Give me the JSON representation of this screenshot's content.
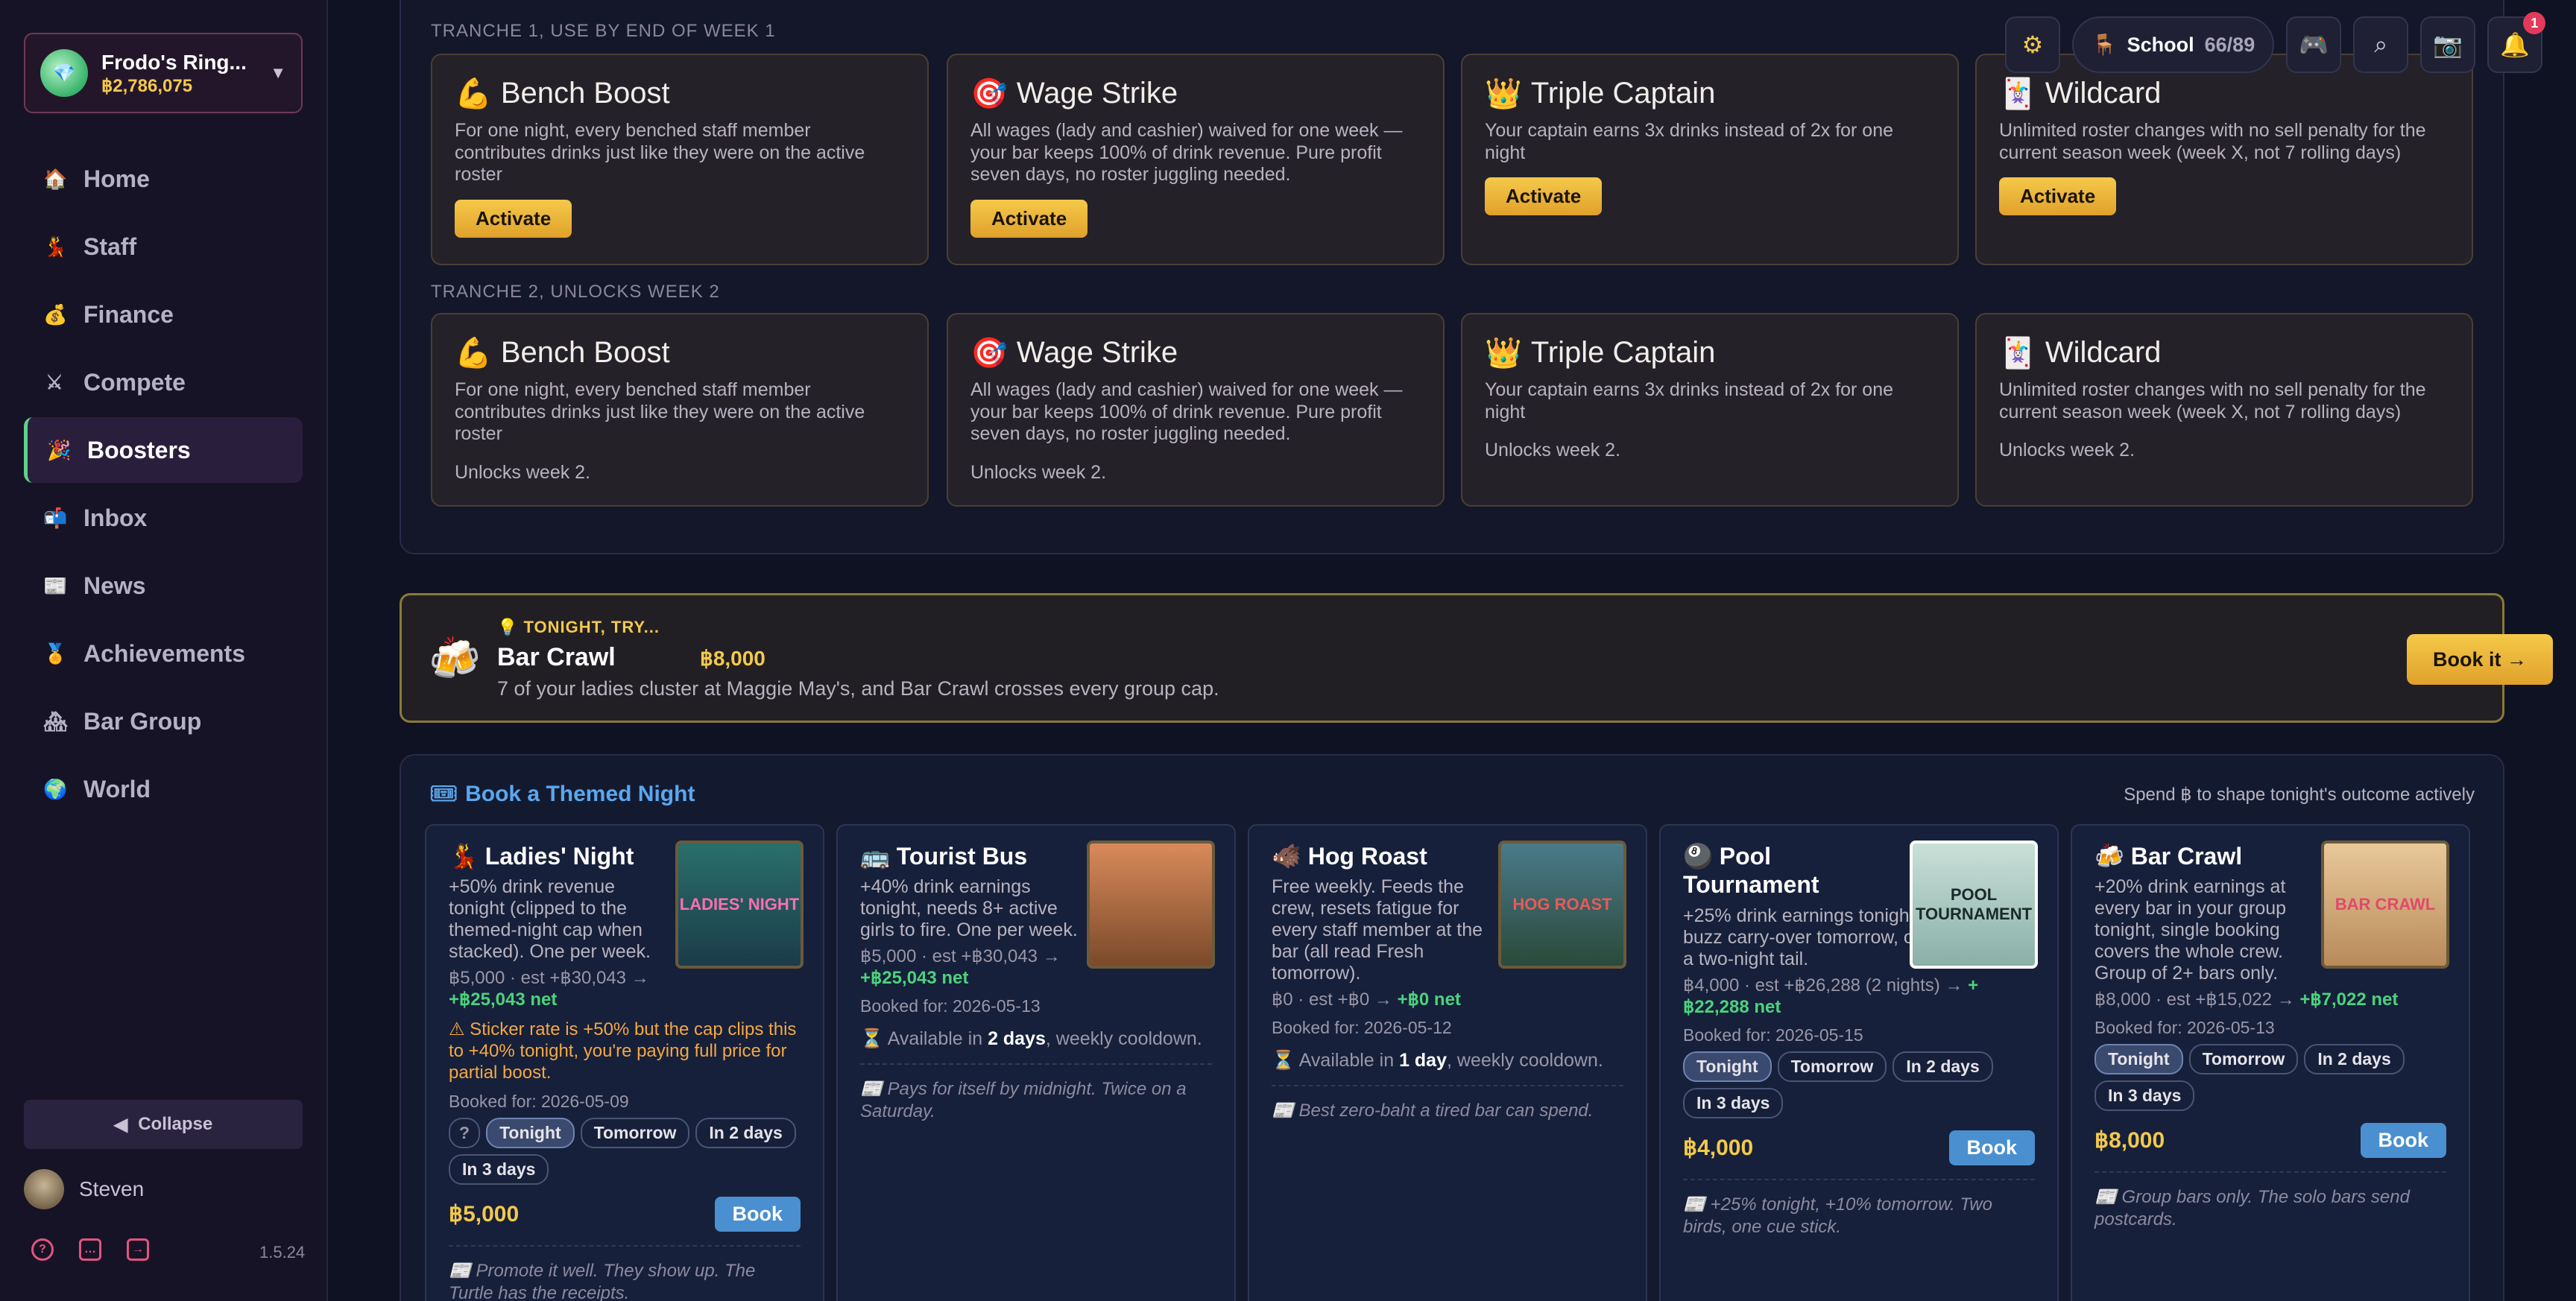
{
  "sidebar": {
    "bar_name": "Frodo's Ring...",
    "bar_balance": "฿2,786,075",
    "items": [
      {
        "label": "Home",
        "icon": "🏠"
      },
      {
        "label": "Staff",
        "icon": "💃"
      },
      {
        "label": "Finance",
        "icon": "💰"
      },
      {
        "label": "Compete",
        "icon": "⚔"
      },
      {
        "label": "Boosters",
        "icon": "🎉"
      },
      {
        "label": "Inbox",
        "icon": "📬"
      },
      {
        "label": "News",
        "icon": "📰"
      },
      {
        "label": "Achievements",
        "icon": "🏅"
      },
      {
        "label": "Bar Group",
        "icon": "🏘"
      },
      {
        "label": "World",
        "icon": "🌍"
      }
    ],
    "collapse_label": "Collapse",
    "user_name": "Steven",
    "version": "1.5.24"
  },
  "header": {
    "school_label": "School",
    "school_count": "66/89",
    "notification_count": "1"
  },
  "tranches": [
    {
      "label": "TRANCHE 1, USE BY END OF WEEK 1",
      "cards": [
        {
          "icon": "💪",
          "title": "Bench Boost",
          "desc": "For one night, every benched staff member contributes drinks just like they were on the active roster",
          "action": "Activate"
        },
        {
          "icon": "🎯",
          "title": "Wage Strike",
          "desc": "All wages (lady and cashier) waived for one week — your bar keeps 100% of drink revenue. Pure profit seven days, no roster juggling needed.",
          "action": "Activate"
        },
        {
          "icon": "👑",
          "title": "Triple Captain",
          "desc": "Your captain earns 3x drinks instead of 2x for one night",
          "action": "Activate"
        },
        {
          "icon": "🃏",
          "title": "Wildcard",
          "desc": "Unlimited roster changes with no sell penalty for the current season week (week X, not 7 rolling days)",
          "action": "Activate"
        }
      ]
    },
    {
      "label": "TRANCHE 2, UNLOCKS WEEK 2",
      "cards": [
        {
          "icon": "💪",
          "title": "Bench Boost",
          "desc": "For one night, every benched staff member contributes drinks just like they were on the active roster",
          "note": "Unlocks week 2."
        },
        {
          "icon": "🎯",
          "title": "Wage Strike",
          "desc": "All wages (lady and cashier) waived for one week — your bar keeps 100% of drink revenue. Pure profit seven days, no roster juggling needed.",
          "note": "Unlocks week 2."
        },
        {
          "icon": "👑",
          "title": "Triple Captain",
          "desc": "Your captain earns 3x drinks instead of 2x for one night",
          "note": "Unlocks week 2."
        },
        {
          "icon": "🃏",
          "title": "Wildcard",
          "desc": "Unlimited roster changes with no sell penalty for the current season week (week X, not 7 rolling days)",
          "note": "Unlocks week 2."
        }
      ]
    }
  ],
  "tonight": {
    "kicker": "💡 TONIGHT, TRY...",
    "title": "Bar Crawl",
    "price": "฿8,000",
    "desc": "7 of your ladies cluster at Maggie May's, and Bar Crawl crosses every group cap.",
    "button": "Book it →"
  },
  "themed": {
    "title": "Book a Themed Night",
    "subtitle": "Spend ฿ to shape tonight's outcome actively",
    "nights": [
      {
        "icon": "💃",
        "title": "Ladies' Night",
        "img_label": "LADIES' NIGHT",
        "desc": "+50% drink revenue tonight (clipped to the themed-night cap when stacked). One per week.",
        "price_line": "฿5,000 · est +฿30,043 →",
        "net": "+฿25,043 net",
        "warning": "⚠ Sticker rate is +50% but the cap clips this to +40% tonight, you're paying full price for partial boost.",
        "booked": "Booked for: 2026-05-09",
        "pills": [
          "Tonight",
          "Tomorrow",
          "In 2 days",
          "In 3 days"
        ],
        "help": "?",
        "price": "฿5,000",
        "book": "Book",
        "quote": "📰 Promote it well. They show up. The Turtle has the receipts."
      },
      {
        "icon": "🚌",
        "title": "Tourist Bus",
        "img_label": "",
        "desc": "+40% drink earnings tonight, needs 8+ active girls to fire. One per week.",
        "price_line": "฿5,000 · est +฿30,043 →",
        "net": "+฿25,043 net",
        "booked": "Booked for: 2026-05-13",
        "avail_pre": "⏳ Available in",
        "avail_b": "2 days",
        "avail_post": ", weekly cooldown.",
        "quote": "📰 Pays for itself by midnight. Twice on a Saturday."
      },
      {
        "icon": "🐗",
        "title": "Hog Roast",
        "img_label": "HOG ROAST",
        "desc": "Free weekly. Feeds the crew, resets fatigue for every staff member at the bar (all read Fresh tomorrow).",
        "price_line": "฿0 · est +฿0 →",
        "net": "+฿0 net",
        "booked": "Booked for: 2026-05-12",
        "avail_pre": "⏳ Available in",
        "avail_b": "1 day",
        "avail_post": ", weekly cooldown.",
        "quote": "📰 Best zero-baht a tired bar can spend."
      },
      {
        "icon": "🎱",
        "title": "Pool Tournament",
        "img_label": "POOL TOURNAMENT",
        "desc": "+25% drink earnings tonight AND a +10% buzz carry-over tomorrow, only event with a two-night tail.",
        "price_line": "฿4,000 · est +฿26,288 (2 nights) →",
        "net": "+฿22,288 net",
        "booked": "Booked for: 2026-05-15",
        "pills": [
          "Tonight",
          "Tomorrow",
          "In 2 days",
          "In 3 days"
        ],
        "price": "฿4,000",
        "book": "Book",
        "quote": "📰 +25% tonight, +10% tomorrow. Two birds, one cue stick."
      },
      {
        "icon": "🍻",
        "title": "Bar Crawl",
        "img_label": "BAR CRAWL",
        "desc": "+20% drink earnings at every bar in your group tonight, single booking covers the whole crew. Group of 2+ bars only.",
        "price_line": "฿8,000 · est +฿15,022 →",
        "net": "+฿7,022 net",
        "booked": "Booked for: 2026-05-13",
        "pills": [
          "Tonight",
          "Tomorrow",
          "In 2 days",
          "In 3 days"
        ],
        "price": "฿8,000",
        "book": "Book",
        "quote": "📰 Group bars only. The solo bars send postcards."
      }
    ]
  },
  "colors": {
    "accent_gold": "#f3c94c",
    "net_green": "#4cd27c",
    "themed_blue": "#5aa7ef",
    "warning_orange": "#f5a742"
  }
}
